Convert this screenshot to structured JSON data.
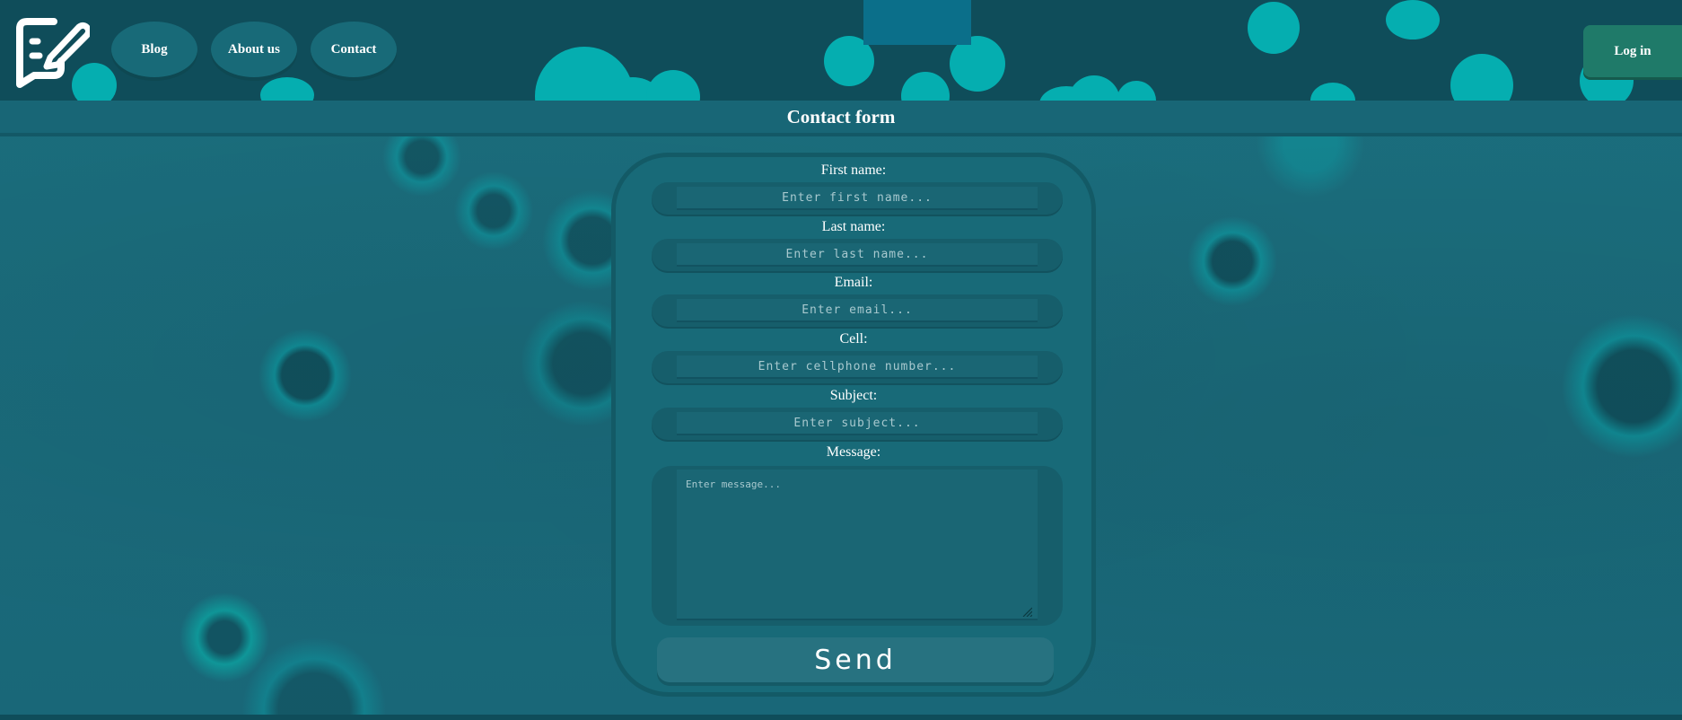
{
  "nav": {
    "items": [
      {
        "label": "Blog"
      },
      {
        "label": "About us"
      },
      {
        "label": "Contact"
      }
    ],
    "login_label": "Log in",
    "logo_icon": "edit-note-icon"
  },
  "page_title": "Contact form",
  "form": {
    "fields": [
      {
        "label": "First name:",
        "placeholder": "Enter first name..."
      },
      {
        "label": "Last name:",
        "placeholder": "Enter last name..."
      },
      {
        "label": "Email:",
        "placeholder": "Enter email..."
      },
      {
        "label": "Cell:",
        "placeholder": "Enter cellphone number..."
      },
      {
        "label": "Subject:",
        "placeholder": "Enter subject..."
      }
    ],
    "message": {
      "label": "Message:",
      "placeholder": "Enter message..."
    },
    "send_label": "Send"
  },
  "colors": {
    "header": "#0f4d5a",
    "background": "#1a6a7a",
    "bubble": "#05aeb0",
    "login": "#1f7a69"
  }
}
